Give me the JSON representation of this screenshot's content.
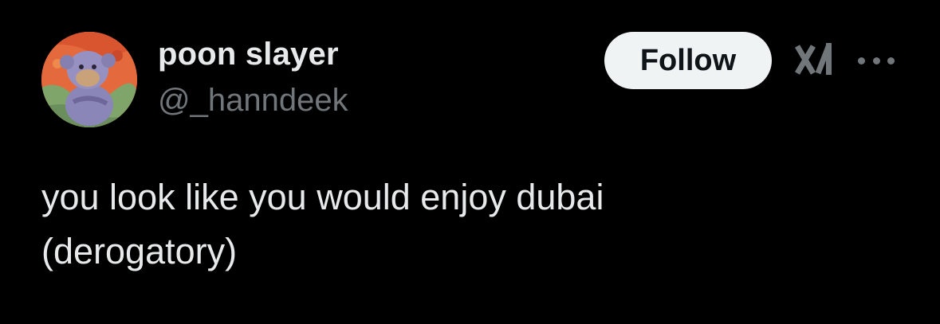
{
  "author": {
    "display_name": "poon slayer",
    "handle": "@_hanndeek",
    "avatar": "monkey-plush-avatar"
  },
  "actions": {
    "follow_label": "Follow",
    "grok_icon": "grok-icon",
    "more_icon": "more-options-icon"
  },
  "tweet": {
    "text_lines": [
      "you look like you would enjoy dubai",
      "(derogatory)"
    ]
  },
  "colors": {
    "background": "#000000",
    "primary_text": "#e7e9ea",
    "secondary_text": "#71767b",
    "follow_bg": "#eff3f4",
    "follow_text": "#0f1419"
  }
}
